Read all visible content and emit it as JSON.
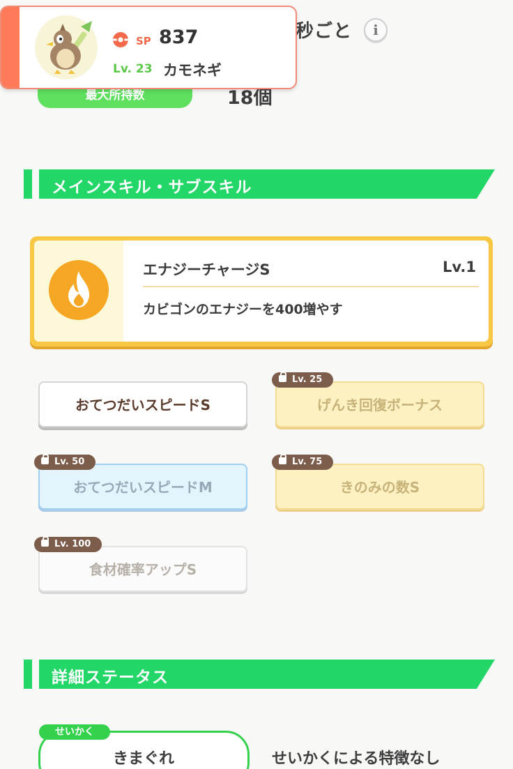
{
  "header": {
    "help_text": "秒ごと",
    "info_icon": "info-icon",
    "max_label": "最大所持数",
    "max_value": "18個"
  },
  "pokemon": {
    "sp_label": "SP",
    "sp_value": "837",
    "level": "Lv. 23",
    "name": "カモネギ",
    "accent_color": "#ff7a58"
  },
  "sections": {
    "skills_title": "メインスキル・サブスキル",
    "status_title": "詳細ステータス"
  },
  "main_skill": {
    "name": "エナジーチャージS",
    "level": "Lv.1",
    "description": "カビゴンのエナジーを400増やす",
    "icon": "fire-icon"
  },
  "sub_skills": [
    {
      "label": "おてつだいスピードS",
      "badge": ""
    },
    {
      "label": "げんき回復ボーナス",
      "badge": "Lv. 25"
    },
    {
      "label": "おてつだいスピードM",
      "badge": "Lv. 50"
    },
    {
      "label": "きのみの数S",
      "badge": "Lv. 75"
    },
    {
      "label": "食材確率アップS",
      "badge": "Lv. 100"
    }
  ],
  "nature": {
    "tag": "せいかく",
    "value": "きまぐれ",
    "description": "せいかくによる特徴なし"
  }
}
